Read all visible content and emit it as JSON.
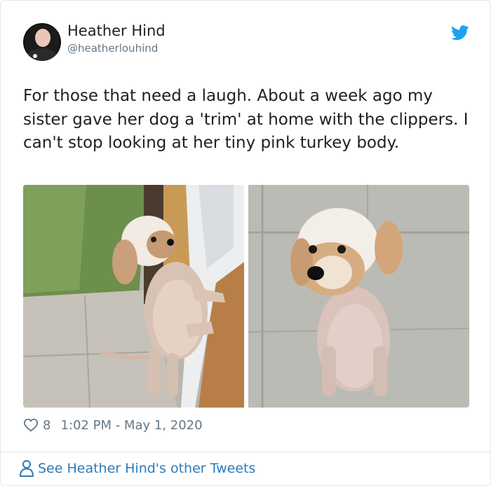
{
  "tweet": {
    "author_name": "Heather Hind",
    "author_handle": "@heatherlouhind",
    "text": "For those that need a laugh. About a week ago my sister gave her dog a 'trim' at home with the clippers. I can't stop looking at her tiny pink turkey body.",
    "likes": "8",
    "timestamp": "1:02 PM - May 1, 2020",
    "more_link": "See Heather Hind's other Tweets"
  },
  "colors": {
    "link": "#2b7bb9",
    "twitter_blue": "#1da1f2",
    "secondary_text": "#657786"
  },
  "icons": [
    "twitter-bird-icon",
    "heart-icon",
    "person-icon"
  ]
}
